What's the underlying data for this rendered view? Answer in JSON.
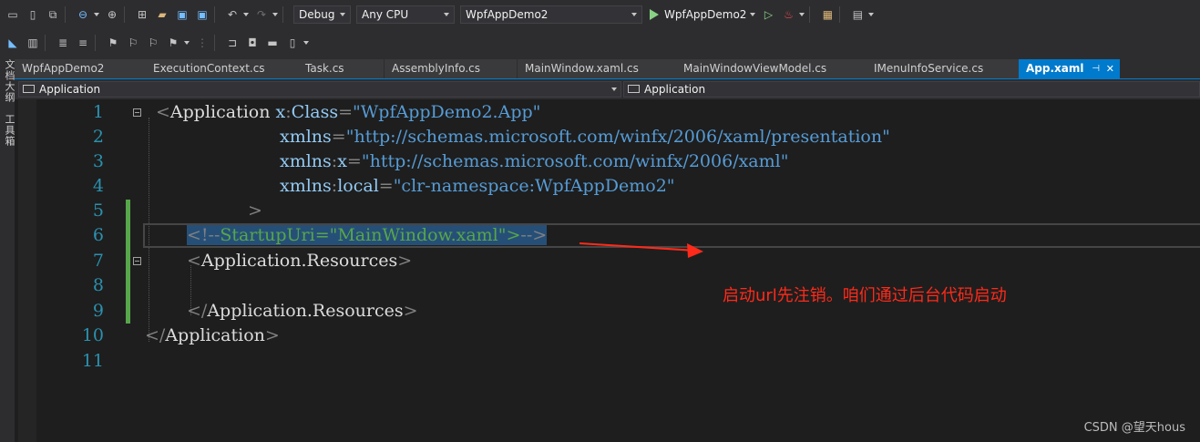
{
  "toolbar": {
    "configuration": "Debug",
    "platform": "Any CPU",
    "startup_project": "WpfAppDemo2",
    "run_label": "WpfAppDemo2"
  },
  "side_panel": {
    "label1": "文档大纲",
    "label2": "工具箱"
  },
  "tabs": [
    {
      "label": "WpfAppDemo2"
    },
    {
      "label": "ExecutionContext.cs"
    },
    {
      "label": "Task.cs"
    },
    {
      "label": "AssemblyInfo.cs"
    },
    {
      "label": "MainWindow.xaml.cs"
    },
    {
      "label": "MainWindowViewModel.cs"
    },
    {
      "label": "IMenuInfoService.cs"
    },
    {
      "label": "App.xaml",
      "active": true
    }
  ],
  "navbar": {
    "left": "Application",
    "right": "Application"
  },
  "editor": {
    "line_numbers": [
      "1",
      "2",
      "3",
      "4",
      "5",
      "6",
      "7",
      "8",
      "9",
      "10",
      "11"
    ],
    "lines": {
      "l1": {
        "open": "<",
        "tag": "Application",
        "attr_prefix": "x",
        "attr_colon": ":",
        "attr_name": "Class",
        "eq": "=",
        "value": "\"WpfAppDemo2.App\""
      },
      "l2": {
        "attr_name": "xmlns",
        "eq": "=",
        "value": "\"http://schemas.microsoft.com/winfx/2006/xaml/presentation\""
      },
      "l3": {
        "attr_prefix": "xmlns",
        "attr_colon": ":",
        "attr_name": "x",
        "eq": "=",
        "value": "\"http://schemas.microsoft.com/winfx/2006/xaml\""
      },
      "l4": {
        "attr_prefix": "xmlns",
        "attr_colon": ":",
        "attr_name": "local",
        "eq": "=",
        "value": "\"clr-namespace:WpfAppDemo2\""
      },
      "l5": {
        "close": ">"
      },
      "l6": {
        "comment_open": "<!--",
        "comment_attr": "StartupUri",
        "comment_eq": "=",
        "comment_value": "\"MainWindow.xaml\"",
        "comment_gt": ">",
        "comment_close": "-->"
      },
      "l7": {
        "open": "<",
        "tag": "Application.Resources",
        "close": ">"
      },
      "l9": {
        "open": "</",
        "tag": "Application.Resources",
        "close": ">"
      },
      "l10": {
        "open": "</",
        "tag": "Application",
        "close": ">"
      }
    }
  },
  "annotation": "启动url先注销。咱们通过后台代码启动",
  "watermark": "CSDN @望天hous",
  "colors": {
    "accent": "#007acc",
    "annotation": "#ff2a1a",
    "line_number": "#2b91af",
    "xml_value": "#569cd6",
    "xml_attr": "#92caf4",
    "comment": "#57a64a"
  },
  "icons": [
    "monitor-icon",
    "save-all-icon",
    "back-icon",
    "forward-icon",
    "new-project-icon",
    "open-folder-icon",
    "save-icon",
    "undo-icon",
    "redo-icon",
    "start-icon",
    "start-without-debug-icon",
    "hot-reload-icon",
    "solution-explorer-icon",
    "bookmark-icon",
    "comment-icon",
    "uncomment-icon"
  ]
}
